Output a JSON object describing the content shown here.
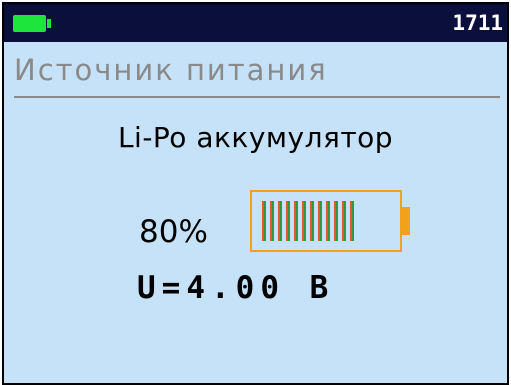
{
  "status_bar": {
    "battery_icon": "battery-full-icon",
    "battery_color": "#1ee53b",
    "time": "1711"
  },
  "screen": {
    "title": "Источник питания",
    "power_type": "Li-Po аккумулятор",
    "charge_percent_text": "80%",
    "charge_level": 0.8,
    "voltage_text": "U=4.00 В"
  },
  "colors": {
    "status_bar_bg": "#0b0f3c",
    "screen_bg": "#c6e2f8",
    "title_text": "#8a8a8a",
    "gauge_outline": "#f2a11b",
    "gauge_segment_red": "#e3592d",
    "gauge_segment_green": "#2f9a3b"
  }
}
